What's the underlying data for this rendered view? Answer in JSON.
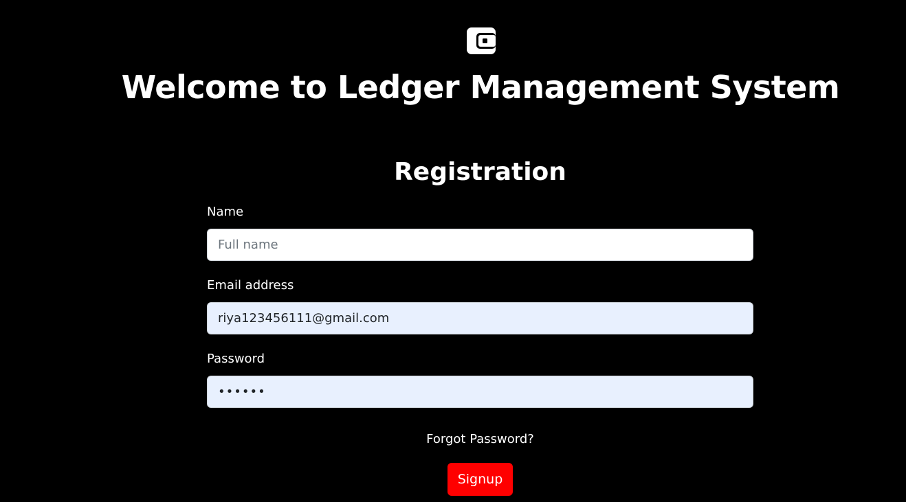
{
  "header": {
    "logo_icon": "wallet-icon",
    "title": "Welcome to Ledger Management System"
  },
  "form": {
    "title": "Registration",
    "name": {
      "label": "Name",
      "placeholder": "Full name",
      "value": ""
    },
    "email": {
      "label": "Email address",
      "value": "riya123456111@gmail.com"
    },
    "password": {
      "label": "Password",
      "value": "••••••"
    },
    "forgot_label": "Forgot Password?",
    "submit_label": "Signup"
  },
  "colors": {
    "background": "#000000",
    "autofill": "#e8f0fe",
    "button": "#ff0000"
  }
}
